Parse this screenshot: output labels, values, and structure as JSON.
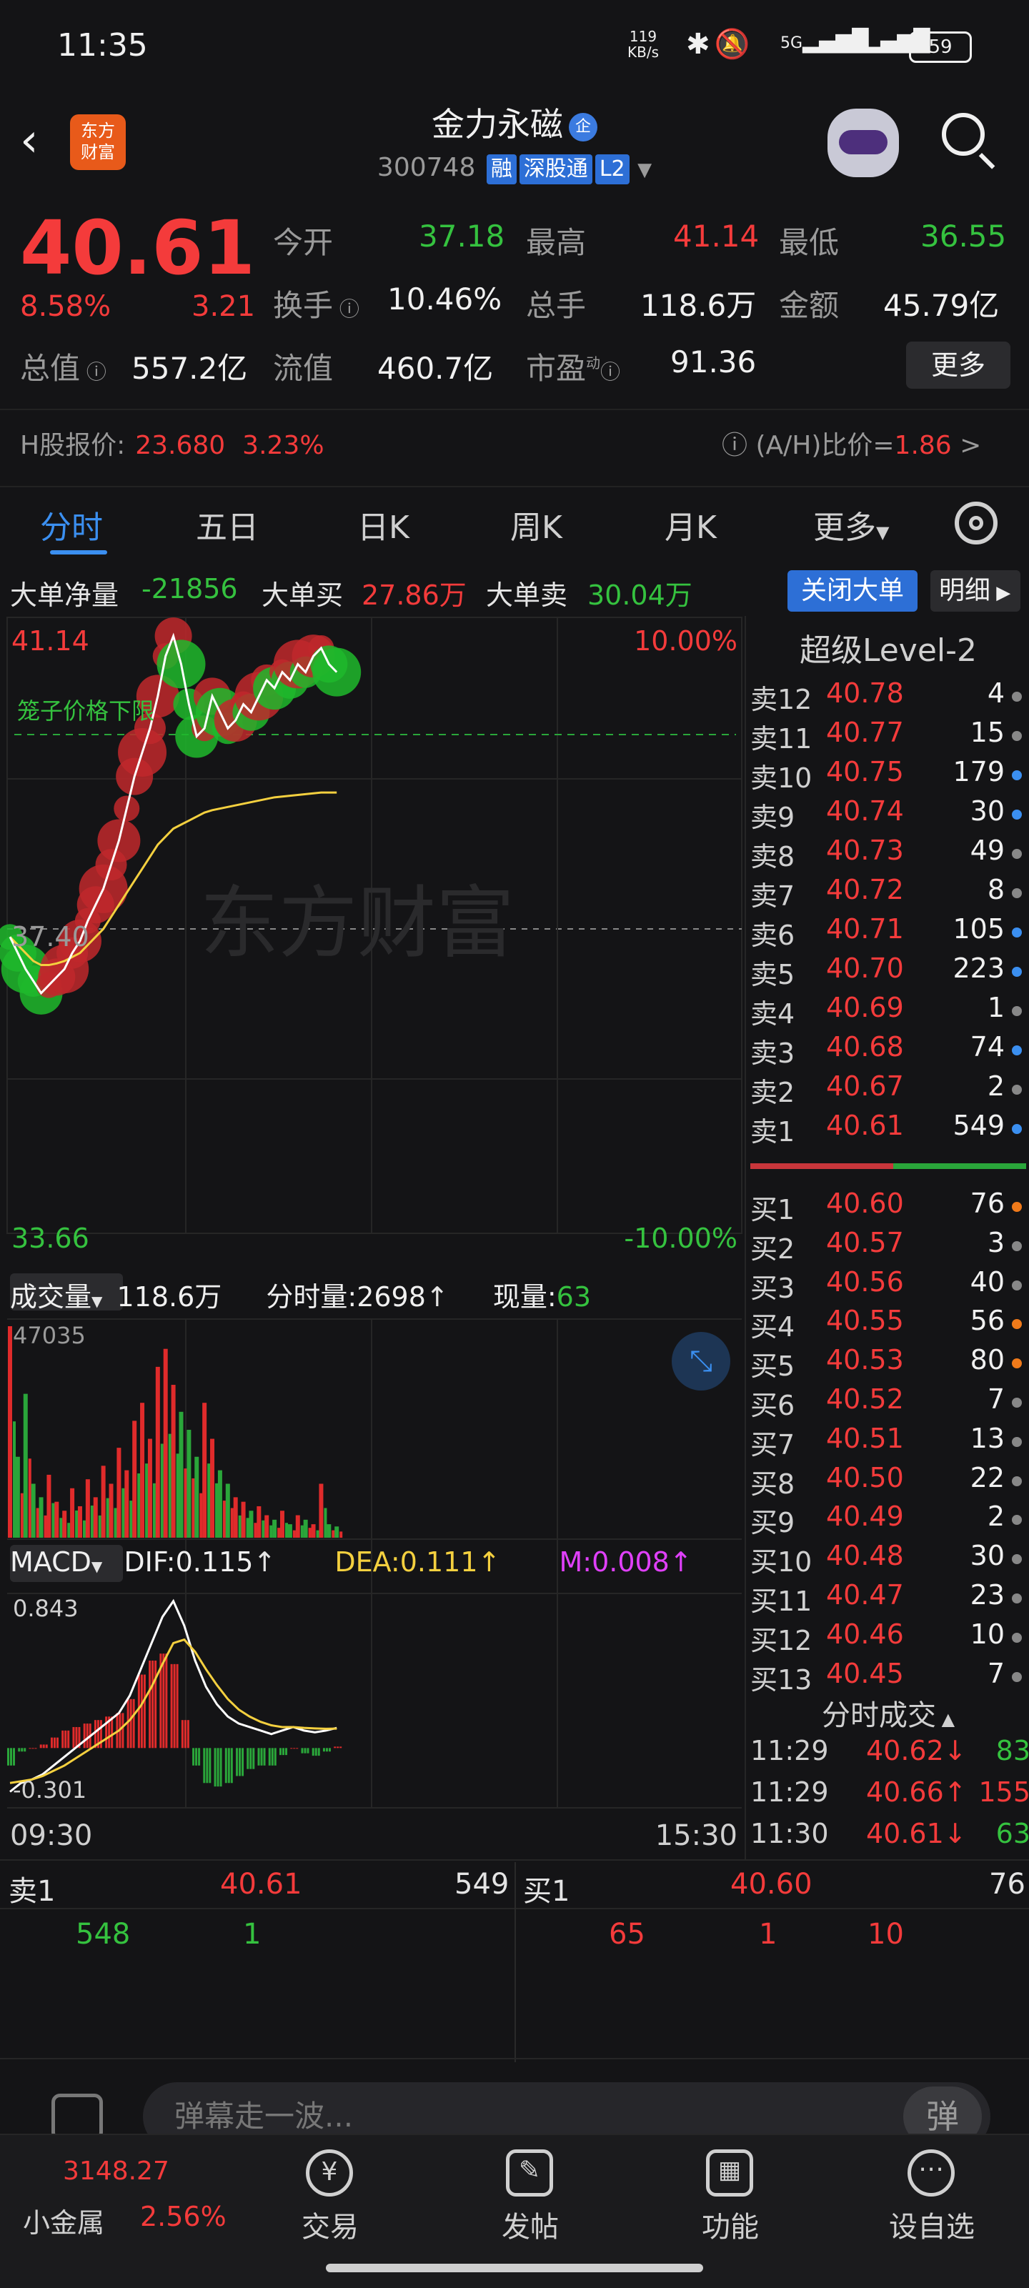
{
  "status": {
    "time": "11:35",
    "net_speed": "119",
    "net_unit": "KB/s",
    "signal1": "5G",
    "signal2": "5G",
    "battery": "59"
  },
  "header": {
    "name": "金力永磁",
    "badge": "企",
    "code": "300748",
    "tags": [
      "融",
      "深股通",
      "L2"
    ],
    "logo_line1": "东方",
    "logo_line2": "财富"
  },
  "quote": {
    "price": "40.61",
    "pct": "8.58%",
    "change": "3.21",
    "open_label": "今开",
    "open": "37.18",
    "high_label": "最高",
    "high": "41.14",
    "low_label": "最低",
    "low": "36.55",
    "turnover_label": "换手",
    "turnover": "10.46%",
    "vol_label": "总手",
    "volume": "118.6万",
    "amount_label": "金额",
    "amount": "45.79亿",
    "mcap_label": "总值",
    "mcap": "557.2亿",
    "float_label": "流值",
    "float_cap": "460.7亿",
    "pe_label": "市盈",
    "pe_sup": "动",
    "pe": "91.36",
    "more": "更多",
    "h_label": "H股报价:",
    "h_price": "23.680",
    "h_pct": "3.23%",
    "ah_label": "(A/H)比价=",
    "ah_value": "1.86",
    "ah_arrow": ">"
  },
  "tabs": [
    "分时",
    "五日",
    "日K",
    "周K",
    "月K",
    "更多"
  ],
  "bigorder": {
    "net_label": "大单净量",
    "net": "-21856",
    "buy_label": "大单买",
    "buy": "27.86万",
    "sell_label": "大单卖",
    "sell": "30.04万",
    "close_btn": "关闭大单",
    "detail_btn": "明细"
  },
  "chart_data": {
    "type": "line",
    "title": "",
    "y_max_label": "41.14",
    "y_mid_label": "37.40",
    "y_min_label": "33.66",
    "pct_max_label": "10.00%",
    "pct_min_label": "-10.00%",
    "ylim": [
      33.66,
      41.14
    ],
    "cage_label": "笼子价格下限",
    "x_start": "09:30",
    "x_end": "15:30",
    "price": [
      37.3,
      37.1,
      36.9,
      36.75,
      36.6,
      36.7,
      36.8,
      36.9,
      37.1,
      37.25,
      37.5,
      37.7,
      37.9,
      38.2,
      38.5,
      38.9,
      39.3,
      39.6,
      39.9,
      40.3,
      40.8,
      41.05,
      40.7,
      40.2,
      39.8,
      39.9,
      40.3,
      40.1,
      39.9,
      40.0,
      40.2,
      40.1,
      40.3,
      40.5,
      40.4,
      40.6,
      40.5,
      40.7,
      40.6,
      40.8,
      40.9,
      40.7,
      40.6
    ],
    "avg": [
      37.3,
      37.2,
      37.1,
      37.0,
      36.95,
      36.95,
      36.97,
      37.0,
      37.05,
      37.1,
      37.2,
      37.3,
      37.4,
      37.55,
      37.7,
      37.85,
      38.0,
      38.15,
      38.3,
      38.45,
      38.55,
      38.65,
      38.7,
      38.75,
      38.8,
      38.85,
      38.88,
      38.9,
      38.92,
      38.94,
      38.96,
      38.98,
      39.0,
      39.02,
      39.04,
      39.05,
      39.06,
      39.07,
      39.08,
      39.09,
      39.1,
      39.1,
      39.1
    ],
    "volume_label": "成交量",
    "volume_total": "118.6万",
    "tick_vol_label": "分时量:",
    "tick_vol": "2698",
    "now_vol_label": "现量:",
    "now_vol": "63",
    "vol_max_label": "47035",
    "volumes": [
      47035,
      18000,
      32000,
      12000,
      9000,
      14000,
      8000,
      6000,
      11000,
      7000,
      13000,
      9000,
      16000,
      12000,
      20000,
      15000,
      26000,
      30000,
      22000,
      38000,
      42000,
      34000,
      28000,
      24000,
      18000,
      30000,
      22000,
      15000,
      12000,
      9000,
      8000,
      6000,
      7000,
      5000,
      4000,
      6000,
      3000,
      5000,
      4000,
      3000,
      12000,
      3000,
      2500
    ],
    "macd_label": "MACD",
    "dif_label": "DIF:",
    "dif": "0.115",
    "dea_label": "DEA:",
    "dea": "0.111",
    "m_label": "M:",
    "m": "0.008",
    "macd_max_label": "0.843",
    "macd_min_label": "-0.301",
    "dif_series": [
      -0.25,
      -0.2,
      -0.18,
      -0.15,
      -0.1,
      -0.05,
      0.0,
      0.05,
      0.1,
      0.15,
      0.2,
      0.3,
      0.45,
      0.6,
      0.75,
      0.84,
      0.7,
      0.5,
      0.35,
      0.25,
      0.18,
      0.14,
      0.12,
      0.1,
      0.08,
      0.1,
      0.12,
      0.1,
      0.09,
      0.1,
      0.115
    ],
    "dea_series": [
      -0.2,
      -0.19,
      -0.18,
      -0.16,
      -0.13,
      -0.1,
      -0.06,
      -0.02,
      0.02,
      0.06,
      0.1,
      0.16,
      0.24,
      0.35,
      0.48,
      0.6,
      0.62,
      0.55,
      0.45,
      0.36,
      0.28,
      0.22,
      0.18,
      0.15,
      0.13,
      0.12,
      0.12,
      0.115,
      0.112,
      0.11,
      0.111
    ],
    "m_series": [
      -0.05,
      -0.01,
      0.0,
      0.01,
      0.03,
      0.05,
      0.06,
      0.07,
      0.08,
      0.09,
      0.1,
      0.14,
      0.21,
      0.25,
      0.27,
      0.24,
      0.08,
      -0.05,
      -0.1,
      -0.11,
      -0.1,
      -0.08,
      -0.06,
      -0.05,
      -0.05,
      -0.02,
      0.0,
      -0.015,
      -0.022,
      -0.01,
      0.004
    ]
  },
  "level2": {
    "title": "超级Level-2",
    "asks": [
      {
        "n": "卖12",
        "p": "40.78",
        "v": "4",
        "dot": "gray"
      },
      {
        "n": "卖11",
        "p": "40.77",
        "v": "15",
        "dot": "gray"
      },
      {
        "n": "卖10",
        "p": "40.75",
        "v": "179",
        "dot": "blue"
      },
      {
        "n": "卖9",
        "p": "40.74",
        "v": "30",
        "dot": "blue"
      },
      {
        "n": "卖8",
        "p": "40.73",
        "v": "49",
        "dot": "gray"
      },
      {
        "n": "卖7",
        "p": "40.72",
        "v": "8",
        "dot": "gray"
      },
      {
        "n": "卖6",
        "p": "40.71",
        "v": "105",
        "dot": "blue"
      },
      {
        "n": "卖5",
        "p": "40.70",
        "v": "223",
        "dot": "blue"
      },
      {
        "n": "卖4",
        "p": "40.69",
        "v": "1",
        "dot": "gray"
      },
      {
        "n": "卖3",
        "p": "40.68",
        "v": "74",
        "dot": "blue"
      },
      {
        "n": "卖2",
        "p": "40.67",
        "v": "2",
        "dot": "gray"
      },
      {
        "n": "卖1",
        "p": "40.61",
        "v": "549",
        "dot": "blue"
      }
    ],
    "bids": [
      {
        "n": "买1",
        "p": "40.60",
        "v": "76",
        "dot": "orange"
      },
      {
        "n": "买2",
        "p": "40.57",
        "v": "3",
        "dot": "gray"
      },
      {
        "n": "买3",
        "p": "40.56",
        "v": "40",
        "dot": "gray"
      },
      {
        "n": "买4",
        "p": "40.55",
        "v": "56",
        "dot": "orange"
      },
      {
        "n": "买5",
        "p": "40.53",
        "v": "80",
        "dot": "orange"
      },
      {
        "n": "买6",
        "p": "40.52",
        "v": "7",
        "dot": "gray"
      },
      {
        "n": "买7",
        "p": "40.51",
        "v": "13",
        "dot": "gray"
      },
      {
        "n": "买8",
        "p": "40.50",
        "v": "22",
        "dot": "gray"
      },
      {
        "n": "买9",
        "p": "40.49",
        "v": "2",
        "dot": "gray"
      },
      {
        "n": "买10",
        "p": "40.48",
        "v": "30",
        "dot": "gray"
      },
      {
        "n": "买11",
        "p": "40.47",
        "v": "23",
        "dot": "gray"
      },
      {
        "n": "买12",
        "p": "40.46",
        "v": "10",
        "dot": "gray"
      },
      {
        "n": "买13",
        "p": "40.45",
        "v": "7",
        "dot": "gray"
      }
    ],
    "trades_title": "分时成交",
    "trades": [
      {
        "t": "11:29",
        "p": "40.62",
        "dir": "↓",
        "q": "83",
        "side": "sell"
      },
      {
        "t": "11:29",
        "p": "40.66",
        "dir": "↑",
        "q": "155",
        "side": "buy"
      },
      {
        "t": "11:30",
        "p": "40.61",
        "dir": "↓",
        "q": "63",
        "side": "sell"
      }
    ]
  },
  "strip": {
    "sell_label": "卖1",
    "sell_price": "40.61",
    "sell_vol": "549",
    "buy_label": "买1",
    "buy_price": "40.60",
    "buy_vol": "76",
    "sell_queue": [
      "548",
      "1"
    ],
    "buy_queue": [
      "65",
      "1",
      "10"
    ]
  },
  "danmu": {
    "placeholder": "弹幕走一波...",
    "btn": "弹"
  },
  "bottom": {
    "sector_value": "3148.27",
    "sector_name": "小金属",
    "sector_pct": "2.56%",
    "items": [
      "交易",
      "发帖",
      "功能",
      "设自选"
    ]
  },
  "colors": {
    "up": "#f43b3b",
    "down": "#35c23f",
    "accent": "#3b8ff0",
    "avg": "#f4d03f",
    "bg": "#141416"
  }
}
